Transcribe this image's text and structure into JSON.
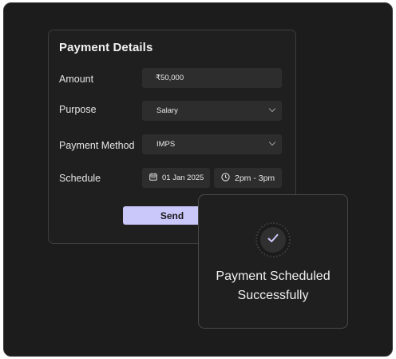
{
  "form": {
    "title": "Payment Details",
    "amount": {
      "label": "Amount",
      "value": "₹50,000"
    },
    "purpose": {
      "label": "Purpose",
      "value": "Salary"
    },
    "method": {
      "label": "Payment Method",
      "value": "IMPS"
    },
    "schedule": {
      "label": "Schedule",
      "date": "01 Jan 2025",
      "time": "2pm - 3pm"
    },
    "send_label": "Send"
  },
  "toast": {
    "message": "Payment Scheduled\nSuccessfully",
    "icon": "check-icon"
  },
  "colors": {
    "accent": "#cac8fb",
    "background": "#1c1c1c",
    "field": "#2d2d2d"
  }
}
